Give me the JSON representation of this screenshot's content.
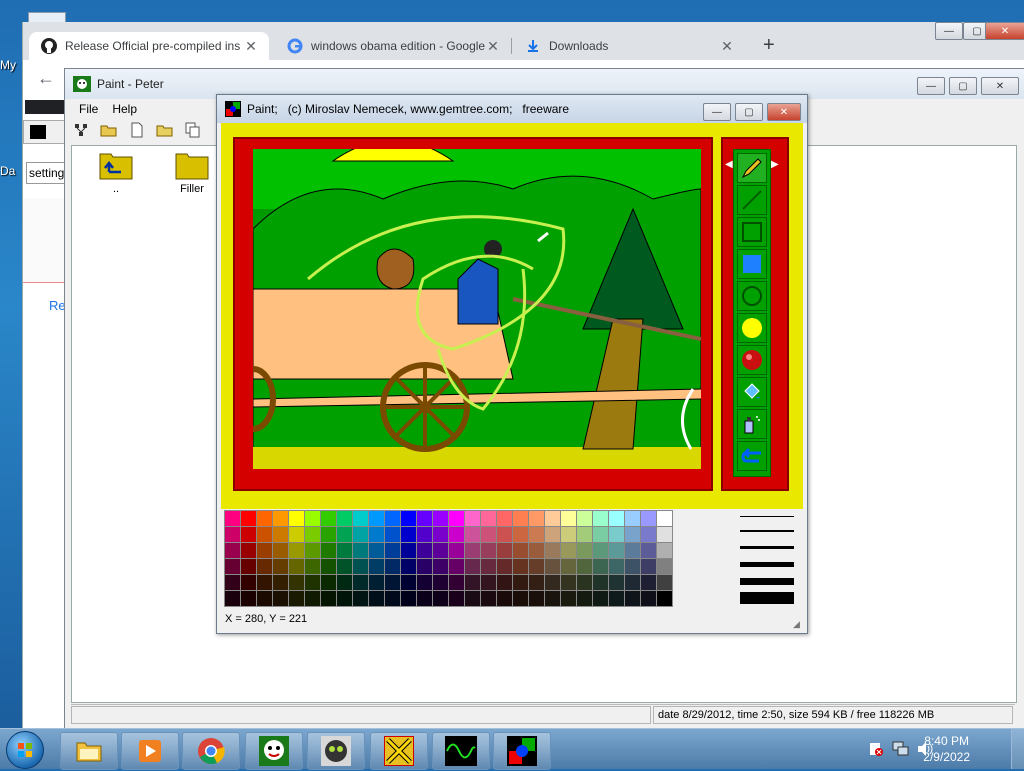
{
  "desktop": {
    "label_top": "My",
    "label_mid": "Da"
  },
  "chrome": {
    "tabs": [
      {
        "label": "Release Official pre-compiled ins",
        "icon": "github-icon"
      },
      {
        "label": "windows obama edition - Google",
        "icon": "google-icon"
      },
      {
        "label": "Downloads",
        "icon": "download-icon"
      }
    ],
    "new_tab": "+",
    "side_input": "setting",
    "side_link": "Re"
  },
  "peter": {
    "title": "Paint - Peter",
    "menu": [
      "File",
      "Help"
    ],
    "folders": [
      {
        "label": ".."
      },
      {
        "label": "Filler"
      }
    ],
    "status": "date 8/29/2012, time 2:50, size 594 KB / free 118226 MB"
  },
  "paint": {
    "title": "Paint;   (c) Miroslav Nemecek, www.gemtree.com;   freeware",
    "coords": "X = 280, Y = 221",
    "tools": [
      "pencil-tool",
      "line-tool",
      "rectangle-tool",
      "filled-rectangle-tool",
      "ellipse-tool",
      "filled-ellipse-tool",
      "sphere-tool",
      "fill-tool",
      "spray-tool",
      "undo-tool"
    ],
    "palette": {
      "rows": [
        [
          "#ff0080",
          "#ff0000",
          "#ff6600",
          "#ff9900",
          "#ffff00",
          "#99ff00",
          "#33cc00",
          "#00cc66",
          "#00cccc",
          "#0099ff",
          "#0066ff",
          "#0000ff",
          "#6600ff",
          "#9900ff",
          "#ff00ff",
          "#ff66cc",
          "#ff6699",
          "#ff6666",
          "#ff7f50",
          "#ff9966",
          "#ffcc99",
          "#ffff99",
          "#ccff99",
          "#99ffcc",
          "#99ffff",
          "#99ccff",
          "#9999ff",
          "#ffffff"
        ],
        [
          "#cc0066",
          "#cc0000",
          "#cc5200",
          "#cc7a00",
          "#cccc00",
          "#7acc00",
          "#29a300",
          "#00a352",
          "#00a3a3",
          "#007acc",
          "#0052cc",
          "#0000cc",
          "#5200cc",
          "#7a00cc",
          "#cc00cc",
          "#cc5299",
          "#cc527a",
          "#cc5252",
          "#cc6640",
          "#cc7a52",
          "#cca37a",
          "#cccc7a",
          "#a3cc7a",
          "#7acca3",
          "#7acccc",
          "#7aa3cc",
          "#7a7acc",
          "#e0e0e0"
        ],
        [
          "#99004d",
          "#990000",
          "#993d00",
          "#995c00",
          "#999900",
          "#5c9900",
          "#1f7a00",
          "#007a3d",
          "#007a7a",
          "#005c99",
          "#003d99",
          "#000099",
          "#3d0099",
          "#5c0099",
          "#990099",
          "#993d73",
          "#993d5c",
          "#993d3d",
          "#994d30",
          "#995c3d",
          "#997a5c",
          "#99995c",
          "#7a995c",
          "#5c997a",
          "#5c9999",
          "#5c7a99",
          "#5c5c99",
          "#b0b0b0"
        ],
        [
          "#660033",
          "#660000",
          "#662900",
          "#663d00",
          "#666600",
          "#3d6600",
          "#145200",
          "#005229",
          "#005252",
          "#003d66",
          "#002966",
          "#000066",
          "#290066",
          "#3d0066",
          "#660066",
          "#66294d",
          "#66293d",
          "#662929",
          "#663320",
          "#663d29",
          "#66523d",
          "#66663d",
          "#52663d",
          "#3d6652",
          "#3d6666",
          "#3d5266",
          "#3d3d66",
          "#808080"
        ],
        [
          "#33001a",
          "#330000",
          "#331400",
          "#331f00",
          "#333300",
          "#1f3300",
          "#0a2900",
          "#002914",
          "#002929",
          "#001f33",
          "#001433",
          "#000033",
          "#140033",
          "#1f0033",
          "#330033",
          "#331426",
          "#33141f",
          "#331414",
          "#331a10",
          "#331f14",
          "#33291f",
          "#33331f",
          "#29331f",
          "#1f3329",
          "#1f3333",
          "#1f2933",
          "#1f1f33",
          "#404040"
        ],
        [
          "#1a000d",
          "#1a0000",
          "#1a0a00",
          "#1a0f00",
          "#1a1a00",
          "#0f1a00",
          "#051400",
          "#00140a",
          "#001414",
          "#000f1a",
          "#000a1a",
          "#00001a",
          "#0a001a",
          "#0f001a",
          "#1a001a",
          "#1a0a13",
          "#1a0a0f",
          "#1a0a0a",
          "#1a0d08",
          "#1a0f0a",
          "#1a140f",
          "#1a1a0f",
          "#141a0f",
          "#0f1a14",
          "#0f1a1a",
          "#0f141a",
          "#0f0f1a",
          "#000000"
        ]
      ]
    },
    "colors": {
      "frame_yellow": "#e8e800",
      "frame_red": "#d40000",
      "canvas_green": "#009a00"
    }
  },
  "taskbar": {
    "apps": [
      "start-orb",
      "explorer-icon",
      "media-player-icon",
      "chrome-icon",
      "peter-app-icon",
      "alien-app-icon",
      "cross-app-icon",
      "oscilloscope-app-icon",
      "paint-app-icon"
    ],
    "time": "8:40 PM",
    "date": "2/9/2022"
  }
}
